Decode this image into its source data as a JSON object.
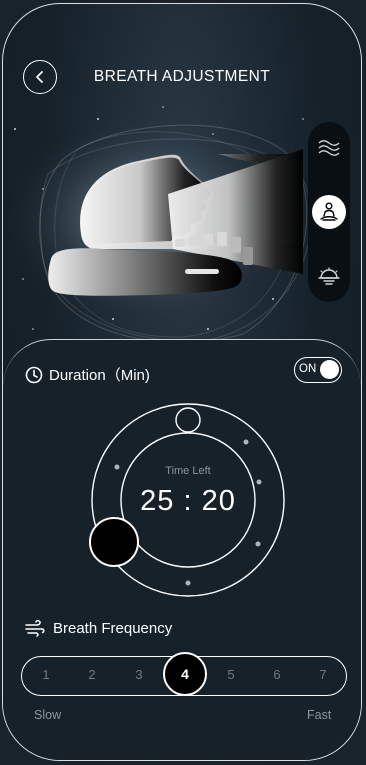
{
  "header": {
    "title": "BREATH ADJUSTMENT"
  },
  "duration": {
    "label": "Duration（Min)",
    "toggle_label": "ON",
    "toggle_on": true
  },
  "timer": {
    "caption": "Time Left",
    "minutes": "25",
    "separator": ":",
    "seconds": "20"
  },
  "frequency": {
    "label": "Breath Frequency",
    "levels": [
      "1",
      "2",
      "3",
      "4",
      "5",
      "6",
      "7"
    ],
    "selected": "4",
    "slow_label": "Slow",
    "fast_label": "Fast"
  },
  "modes": [
    {
      "icon": "waves-icon",
      "active": false
    },
    {
      "icon": "meditation-icon",
      "active": true
    },
    {
      "icon": "sunrise-icon",
      "active": false
    }
  ]
}
